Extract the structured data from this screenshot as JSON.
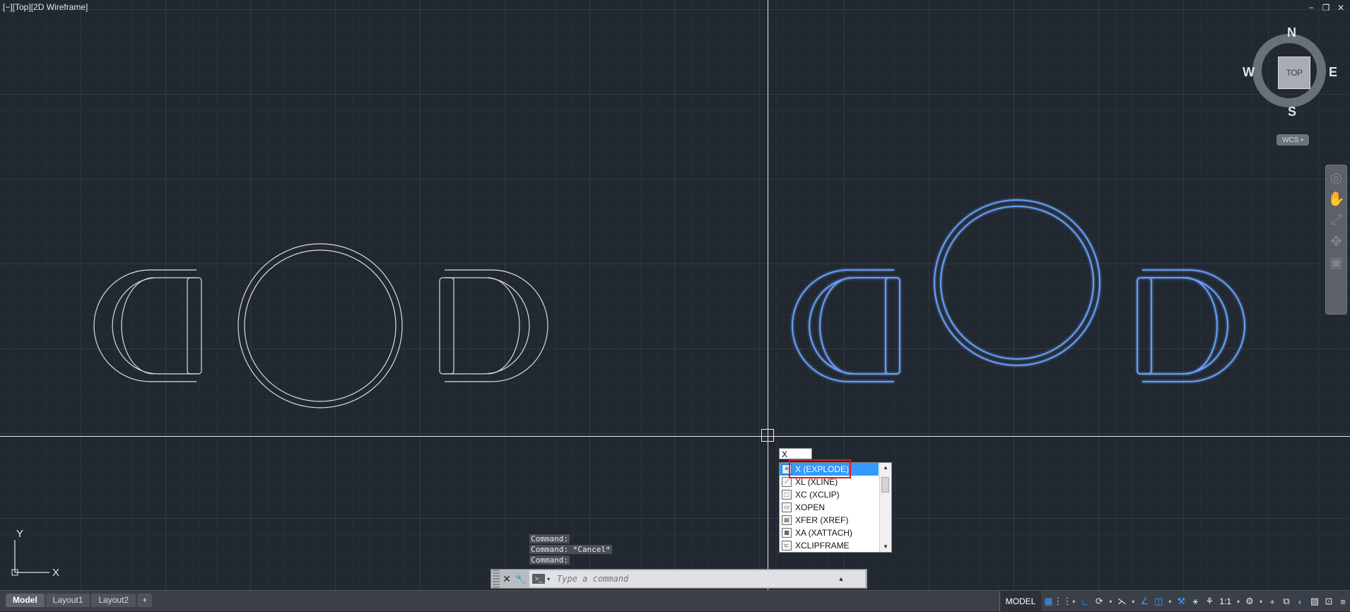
{
  "viewport": {
    "label": "[−][Top][2D Wireframe]"
  },
  "window_controls": {
    "minimize": "−",
    "restore": "❐",
    "close": "✕"
  },
  "viewcube": {
    "face": "TOP",
    "north": "N",
    "south": "S",
    "east": "E",
    "west": "W",
    "wcs": "WCS"
  },
  "dyn_input": {
    "value": "X"
  },
  "autocomplete": {
    "items": [
      {
        "label": "X (EXPLODE)",
        "icon": "explode-icon",
        "selected": true
      },
      {
        "label": "XL (XLINE)",
        "icon": "xline-icon"
      },
      {
        "label": "XC (XCLIP)",
        "icon": "xclip-icon"
      },
      {
        "label": "XOPEN",
        "icon": "xopen-icon"
      },
      {
        "label": "XFER (XREF)",
        "icon": "xref-icon"
      },
      {
        "label": "XA (XATTACH)",
        "icon": "xattach-icon"
      },
      {
        "label": "XCLIPFRAME",
        "icon": "xclipframe-icon"
      }
    ]
  },
  "command_history": [
    "Command:",
    "Command: *Cancel*",
    "Command:"
  ],
  "command_line": {
    "placeholder": "Type a command"
  },
  "ucs": {
    "x": "X",
    "y": "Y"
  },
  "tabs": {
    "model": "Model",
    "layout1": "Layout1",
    "layout2": "Layout2",
    "add": "+"
  },
  "statusbar": {
    "model": "MODEL",
    "scale": "1:1"
  },
  "colors": {
    "background": "#212830",
    "selection": "#5b8fe8",
    "highlight": "#e8141b",
    "listSelected": "#3399ff"
  }
}
